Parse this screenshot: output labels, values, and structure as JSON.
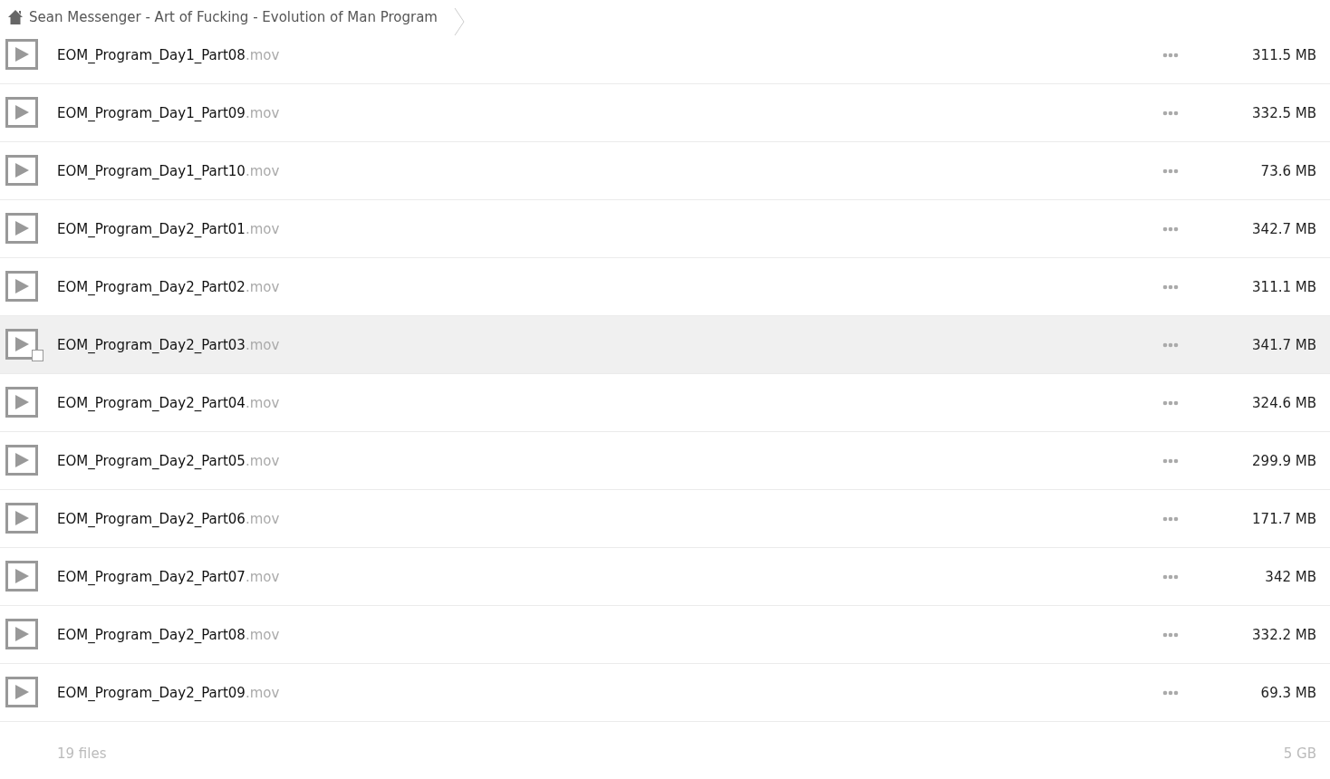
{
  "breadcrumb": {
    "label": "Sean Messenger - Art of Fucking - Evolution of Man Program"
  },
  "files": [
    {
      "name": "EOM_Program_Day1_Part08",
      "ext": ".mov",
      "size": "311.5 MB",
      "hovered": false
    },
    {
      "name": "EOM_Program_Day1_Part09",
      "ext": ".mov",
      "size": "332.5 MB",
      "hovered": false
    },
    {
      "name": "EOM_Program_Day1_Part10",
      "ext": ".mov",
      "size": "73.6 MB",
      "hovered": false
    },
    {
      "name": "EOM_Program_Day2_Part01",
      "ext": ".mov",
      "size": "342.7 MB",
      "hovered": false
    },
    {
      "name": "EOM_Program_Day2_Part02",
      "ext": ".mov",
      "size": "311.1 MB",
      "hovered": false
    },
    {
      "name": "EOM_Program_Day2_Part03",
      "ext": ".mov",
      "size": "341.7 MB",
      "hovered": true
    },
    {
      "name": "EOM_Program_Day2_Part04",
      "ext": ".mov",
      "size": "324.6 MB",
      "hovered": false
    },
    {
      "name": "EOM_Program_Day2_Part05",
      "ext": ".mov",
      "size": "299.9 MB",
      "hovered": false
    },
    {
      "name": "EOM_Program_Day2_Part06",
      "ext": ".mov",
      "size": "171.7 MB",
      "hovered": false
    },
    {
      "name": "EOM_Program_Day2_Part07",
      "ext": ".mov",
      "size": "342 MB",
      "hovered": false
    },
    {
      "name": "EOM_Program_Day2_Part08",
      "ext": ".mov",
      "size": "332.2 MB",
      "hovered": false
    },
    {
      "name": "EOM_Program_Day2_Part09",
      "ext": ".mov",
      "size": "69.3 MB",
      "hovered": false
    }
  ],
  "summary": {
    "count": "19 files",
    "total": "5 GB"
  }
}
